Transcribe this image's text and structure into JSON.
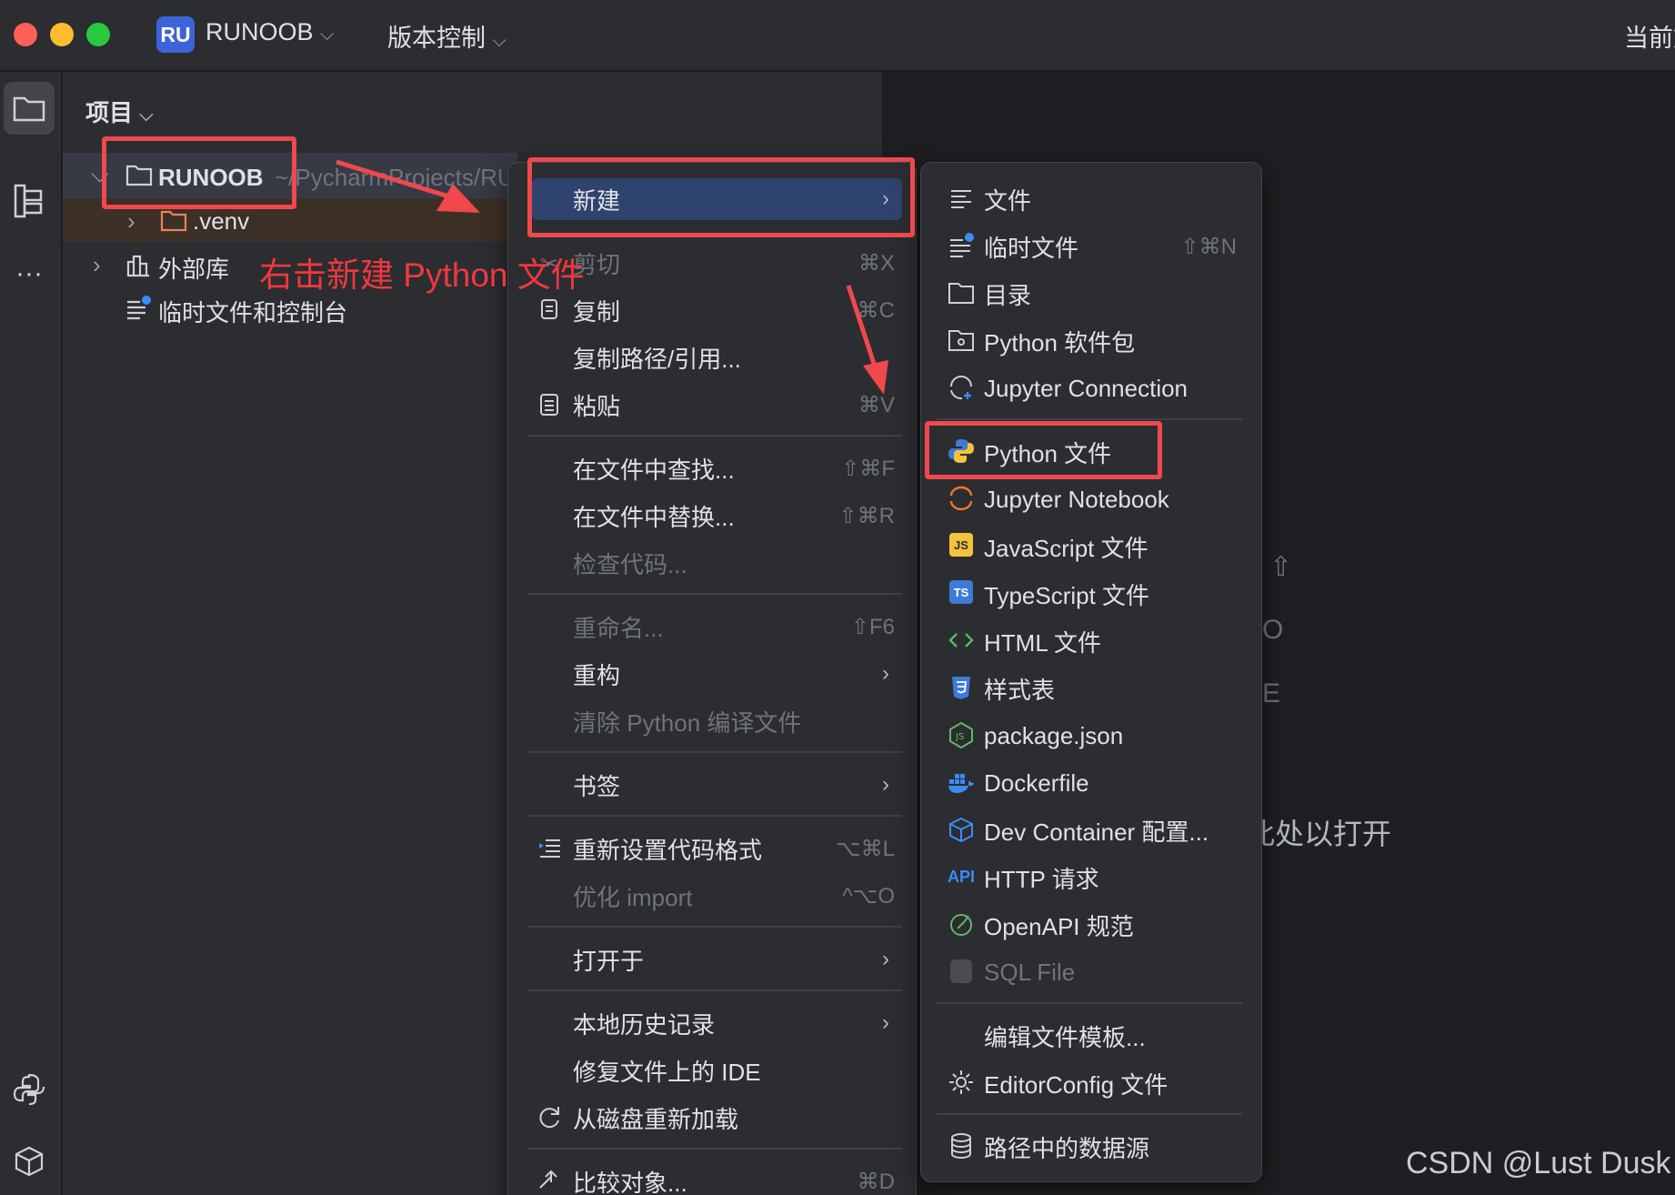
{
  "titlebar": {
    "project_badge": "RU",
    "project_name": "RUNOOB",
    "vcs_label": "版本控制",
    "right_text": "当前文"
  },
  "panel": {
    "title": "项目",
    "tree": {
      "root_name": "RUNOOB",
      "root_path": "~/PycharmProjects/RU",
      "venv": ".venv",
      "external_libs": "外部库",
      "scratches": "临时文件和控制台"
    }
  },
  "annotation": "右击新建 Python 文件",
  "context_menu": {
    "new": "新建",
    "cut": "剪切",
    "cut_sc": "⌘X",
    "copy": "复制",
    "copy_sc": "⌘C",
    "copy_path": "复制路径/引用...",
    "paste": "粘贴",
    "paste_sc": "⌘V",
    "find_in_files": "在文件中查找...",
    "find_in_files_sc": "⇧⌘F",
    "replace_in_files": "在文件中替换...",
    "replace_in_files_sc": "⇧⌘R",
    "inspect_code": "检查代码...",
    "rename": "重命名...",
    "rename_sc": "⇧F6",
    "refactor": "重构",
    "clean_python": "清除 Python 编译文件",
    "bookmarks": "书签",
    "reformat": "重新设置代码格式",
    "reformat_sc": "⌥⌘L",
    "optimize_imports": "优化 import",
    "optimize_imports_sc": "^⌥O",
    "open_in": "打开于",
    "local_history": "本地历史记录",
    "repair_ide": "修复文件上的 IDE",
    "reload_disk": "从磁盘重新加载",
    "compare_with": "比较对象...",
    "compare_with_sc": "⌘D"
  },
  "new_submenu": {
    "file": "文件",
    "scratch": "临时文件",
    "scratch_sc": "⇧⌘N",
    "directory": "目录",
    "python_package": "Python 软件包",
    "jupyter_connection": "Jupyter Connection",
    "python_file": "Python 文件",
    "jupyter_notebook": "Jupyter Notebook",
    "javascript": "JavaScript 文件",
    "typescript": "TypeScript 文件",
    "html": "HTML 文件",
    "stylesheet": "样式表",
    "package_json": "package.json",
    "dockerfile": "Dockerfile",
    "dev_container": "Dev Container 配置...",
    "http_request": "HTTP 请求",
    "openapi": "OpenAPI 规范",
    "sql_file": "SQL File",
    "edit_templates": "编辑文件模板...",
    "editorconfig": "EditorConfig 文件",
    "data_source": "路径中的数据源"
  },
  "editor_hint": "此处以打开",
  "watermark": "CSDN @Lust Dusk",
  "colors": {
    "background": "#1e1f22",
    "panel": "#2b2d30",
    "selection": "#2e436e",
    "annotation_red": "#f0484d",
    "accent_blue": "#3d63d8"
  }
}
